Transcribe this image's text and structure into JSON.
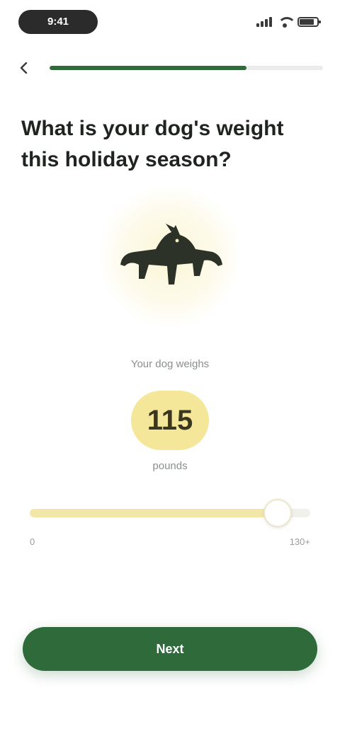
{
  "status_bar": {
    "time": "9:41"
  },
  "question": {
    "text": "What is your dog's weight this holiday season?"
  },
  "illustration": {
    "icon": "dog-icon"
  },
  "weight": {
    "caption": "Your dog weighs",
    "value": "115",
    "unit": "pounds",
    "min": 0,
    "max": 130,
    "min_label": "0",
    "max_label": "130+"
  },
  "progress": {
    "fraction": 0.72
  },
  "cta": {
    "label": "Next"
  },
  "colors": {
    "accent": "#2f6b3a",
    "highlight": "#f5e79a"
  }
}
